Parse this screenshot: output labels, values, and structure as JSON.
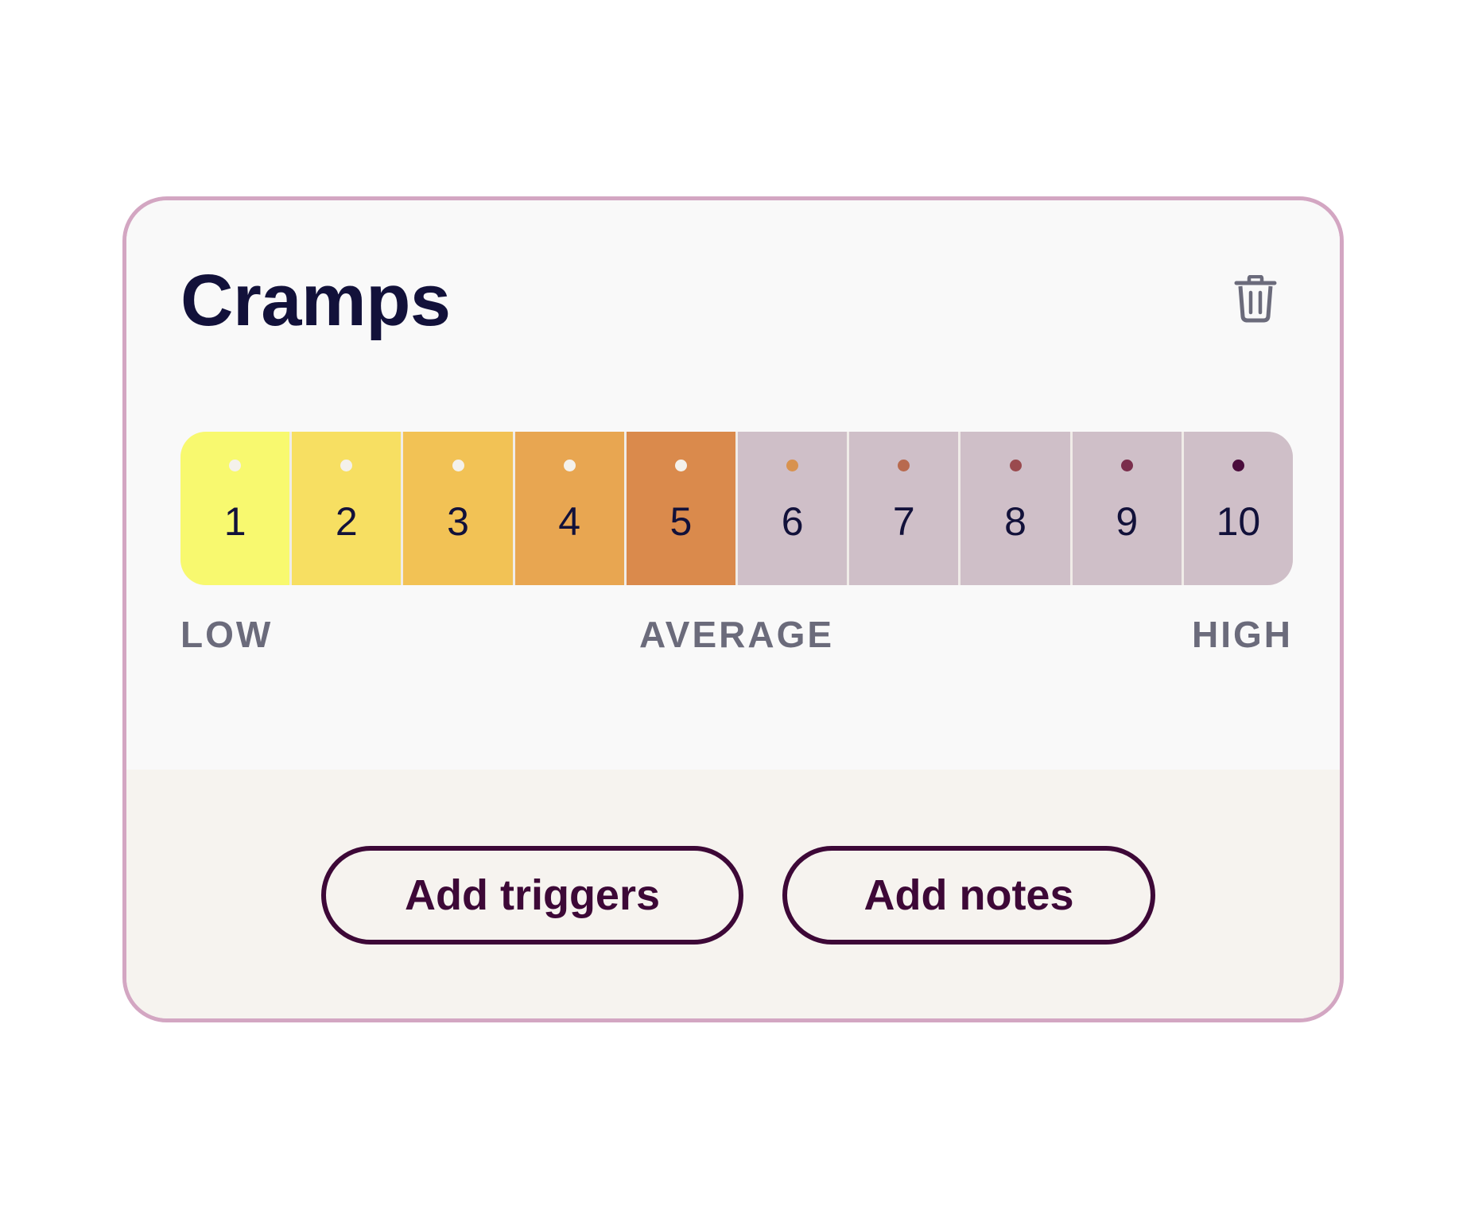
{
  "card": {
    "title": "Cramps",
    "delete_icon": "trash-icon"
  },
  "scale": {
    "cells": [
      {
        "label": "1",
        "bg": "#f8f96f",
        "dot": "#f4f1eb"
      },
      {
        "label": "2",
        "bg": "#f7df62",
        "dot": "#f4f1eb"
      },
      {
        "label": "3",
        "bg": "#f2c255",
        "dot": "#f4f1eb"
      },
      {
        "label": "4",
        "bg": "#e8a651",
        "dot": "#f4f1eb"
      },
      {
        "label": "5",
        "bg": "#da8a4c",
        "dot": "#f4f1eb"
      },
      {
        "label": "6",
        "bg": "#cfbfc8",
        "dot": "#d8924f"
      },
      {
        "label": "7",
        "bg": "#cfbfc8",
        "dot": "#b86a4e"
      },
      {
        "label": "8",
        "bg": "#cfbfc8",
        "dot": "#9a4a4e"
      },
      {
        "label": "9",
        "bg": "#cfbfc8",
        "dot": "#7a2e4c"
      },
      {
        "label": "10",
        "bg": "#cfbfc8",
        "dot": "#4a0c3c"
      }
    ],
    "low_label": "LOW",
    "average_label": "AVERAGE",
    "high_label": "HIGH"
  },
  "actions": {
    "add_triggers": "Add triggers",
    "add_notes": "Add notes"
  },
  "colors": {
    "card_border": "#d3a6c2",
    "title": "#12113a",
    "button": "#3d0837",
    "scale_label": "#6b6b7b"
  }
}
